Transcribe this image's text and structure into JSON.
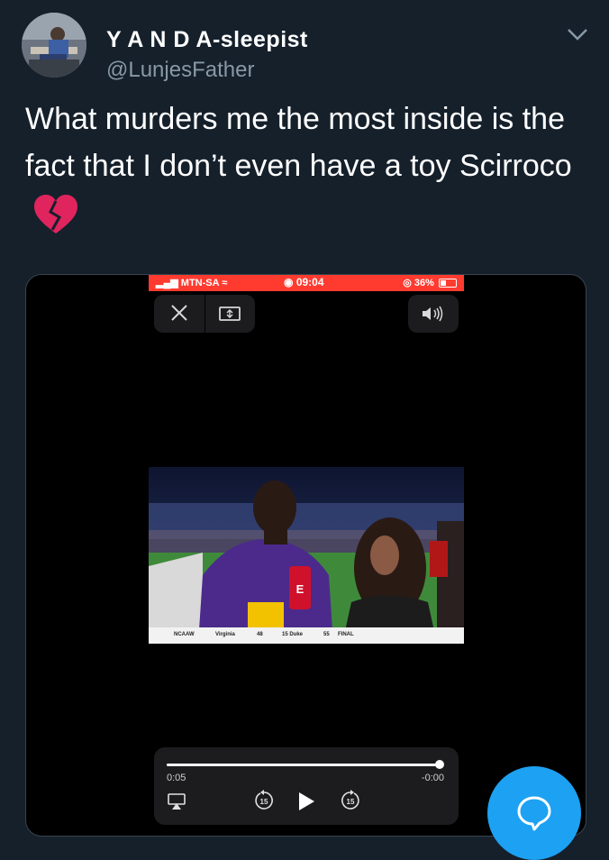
{
  "tweet": {
    "display_name": "Y A N D A-sleepist",
    "handle": "@LunjesFather",
    "text": "What murders me the most inside is the fact that I don’t even have a toy Scirroco",
    "emoji": "broken-heart-icon"
  },
  "media": {
    "status_bar": {
      "carrier": "MTN-SA",
      "time": "09:04",
      "battery": "36%",
      "color": "#ff3b30"
    },
    "scorebug": {
      "league": "NCAAW",
      "team1": "Virginia",
      "score1": "48",
      "team2": "15 Duke",
      "score2": "55",
      "status": "FINAL"
    },
    "player": {
      "elapsed": "0:05",
      "remaining": "-0:00",
      "progress": 0.99
    }
  },
  "colors": {
    "background": "#15202b",
    "accent": "#1da1f2",
    "muted": "#8899a6"
  }
}
